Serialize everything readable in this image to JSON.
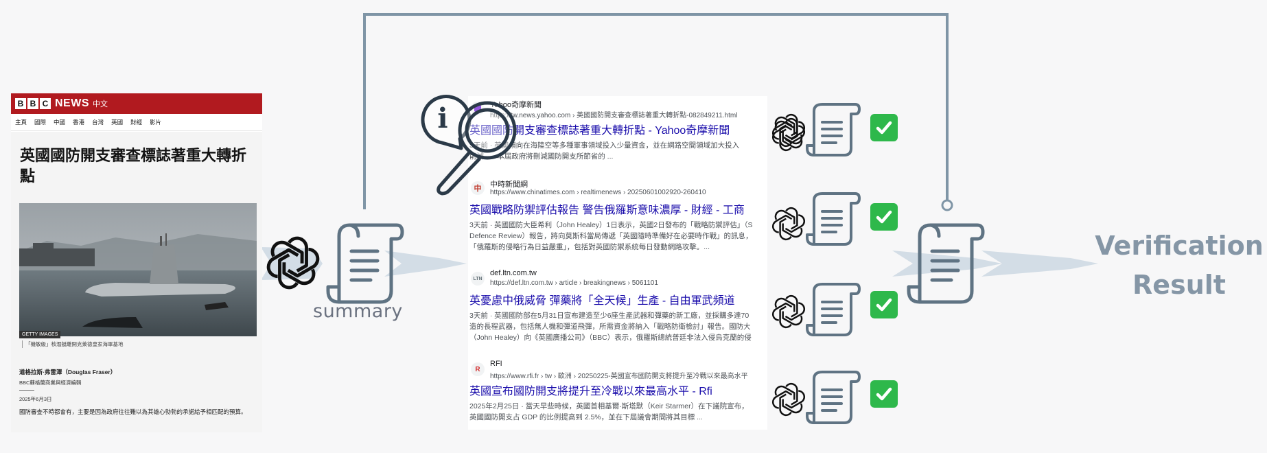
{
  "bbc": {
    "logo_letters": [
      "B",
      "B",
      "C"
    ],
    "news_label": "NEWS",
    "zh_label": "中文",
    "nav": [
      "主頁",
      "國際",
      "中國",
      "香港",
      "台灣",
      "英國",
      "財經",
      "影片"
    ],
    "headline": "英國國防開支審查標誌著重大轉折點",
    "photo_credit": "GETTY IMAGES",
    "caption": "「機敏級」核潛艇離開克萊德皇家海軍基地",
    "author": "道格拉斯·弗雷澤（Douglas Fraser）",
    "author_role": "BBC蘇格蘭商業與經濟編輯",
    "date": "2025年6月3日",
    "body": "國防審查不時都會有，主要是因為政府往往難以為其雄心勃勃的承諾給予相匹配的預算。"
  },
  "search": {
    "results": [
      {
        "site": "Yahoo奇摩新聞",
        "url": "https://tw.news.yahoo.com › 英國國防開支審查標誌著重大轉折點-082849211.html",
        "title": "英國國防開支審查標誌著重大轉折點 - Yahoo奇摩新聞",
        "snippet1": "3天前 · 英國傾向在海陸空等多種軍事領域投入少量資金，並在網路空間領域加大投入",
        "snippet2": "削減...。本屆政府將刪減國防開支所節省的 ...",
        "snippet3": ""
      },
      {
        "site": "中時新聞網",
        "url": "https://www.chinatimes.com › realtimenews › 20250601002920-260410",
        "title": "英國戰略防禦評估報告 警告俄羅斯意味濃厚 - 財經 - 工商",
        "snippet1": "3天前 · 英國國防大臣希利（John Healey）1日表示，英國2日發布的「戰略防禦評估」（S",
        "snippet2": "Defence Review）報告，將向莫斯科當局傳遞「英國隨時準備好在必要時作戰」的訊息，",
        "snippet3": "「俄羅斯的侵略行為日益嚴重」，包括對英國防禦系統每日發動網路攻擊。..."
      },
      {
        "site": "def.ltn.com.tw",
        "url": "https://def.ltn.com.tw › article › breakingnews › 5061101",
        "title": "英憂慮中俄威脅 彈藥將「全天候」生產 - 自由軍武頻道",
        "snippet1": "3天前 · 英國國防部在5月31日宣布建造至少6座生產武器和彈藥的新工廠，並採購多達70",
        "snippet2": "造的長程武器，包括無人機和彈道飛彈，所需資金將納入「戰略防衛檢討」報告。國防大",
        "snippet3": "（John Healey）向《英國廣播公司》（BBC）表示，俄羅斯總統普廷非法入侵烏克蘭的侵"
      },
      {
        "site": "RFI",
        "url": "https://www.rfi.fr › tw › 歐洲 › 20250225-英國宣布國防開支將提升至冷戰以來最高水平",
        "title": "英國宣布國防開支將提升至冷戰以來最高水平 - Rfi",
        "snippet1": "2025年2月25日 · 當天早些時候，英國首相基爾·斯塔默（Keir Starmer）在下議院宣布，",
        "snippet2": "英國國防開支占 GDP 的比例提高到 2.5%，並在下屆議會期間將其目標 ...",
        "snippet3": ""
      }
    ]
  },
  "labels": {
    "summary": "summary",
    "result_line1": "Verification",
    "result_line2": "Result"
  },
  "colors": {
    "line": "#7f95a6",
    "doc": "#5f7383",
    "arrow": "#c9d6e1",
    "check": "#2eb84b",
    "bbc_red": "#b11a1f",
    "link": "#1a0dab"
  }
}
